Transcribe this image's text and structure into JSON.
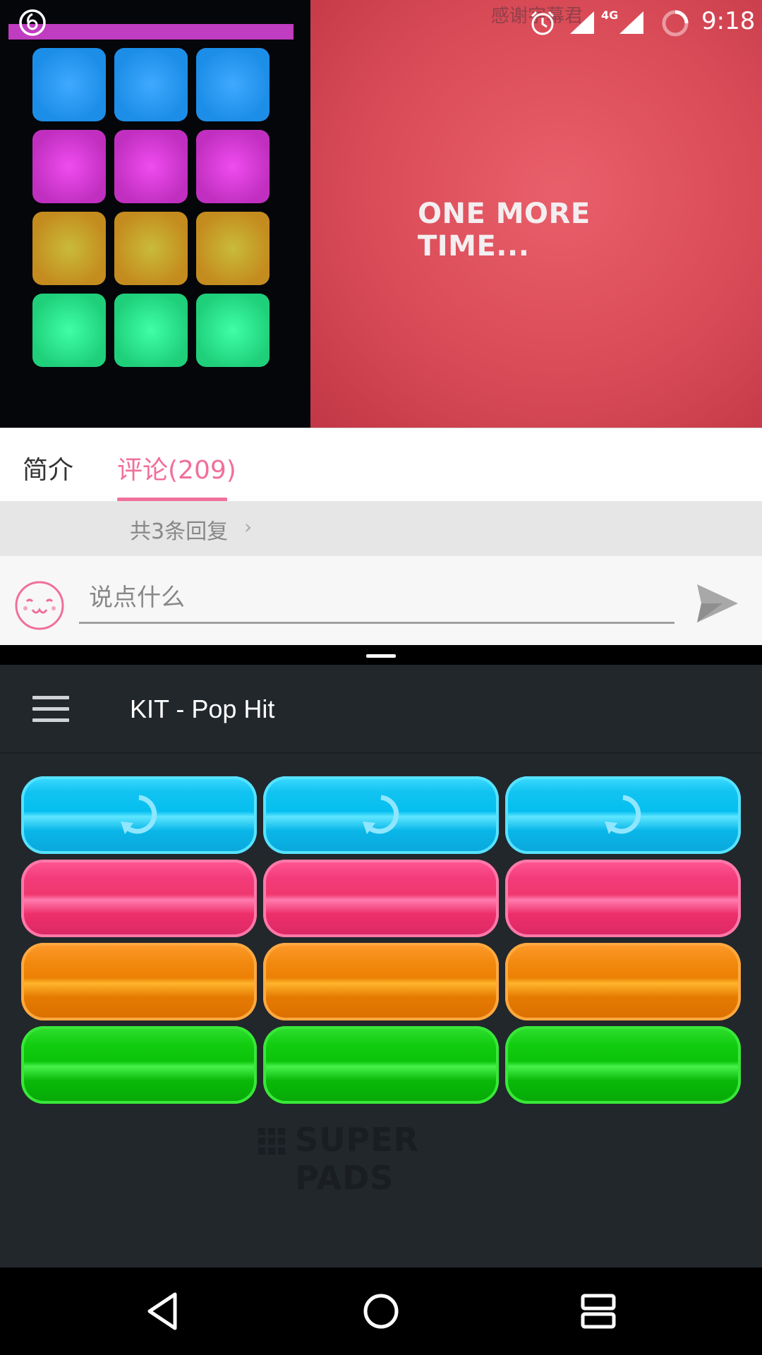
{
  "status_bar": {
    "danmu_text": "感谢字幕君",
    "network_label": "4G",
    "time": "9:18",
    "icons": [
      "app-netease-icon",
      "alarm-icon",
      "signal-icon",
      "battery-icon"
    ]
  },
  "video": {
    "overlay_text": "ONE MORE TIME..."
  },
  "tabs": [
    {
      "label": "简介",
      "active": false
    },
    {
      "label": "评论(209)",
      "active": true
    }
  ],
  "replies": {
    "label": "共3条回复"
  },
  "composer": {
    "placeholder": "说点什么"
  },
  "pads_app": {
    "title": "KIT - Pop Hit",
    "brand": "SUPER PADS",
    "rows": [
      {
        "color": "blue",
        "hex": "#05bff0",
        "icon": "loop-icon"
      },
      {
        "color": "pink",
        "hex": "#f0386f",
        "icon": ""
      },
      {
        "color": "orange",
        "hex": "#ec8004",
        "icon": ""
      },
      {
        "color": "green",
        "hex": "#0bc40a",
        "icon": ""
      }
    ]
  },
  "colors": {
    "accent": "#f0709a",
    "app_background": "#22272c"
  }
}
